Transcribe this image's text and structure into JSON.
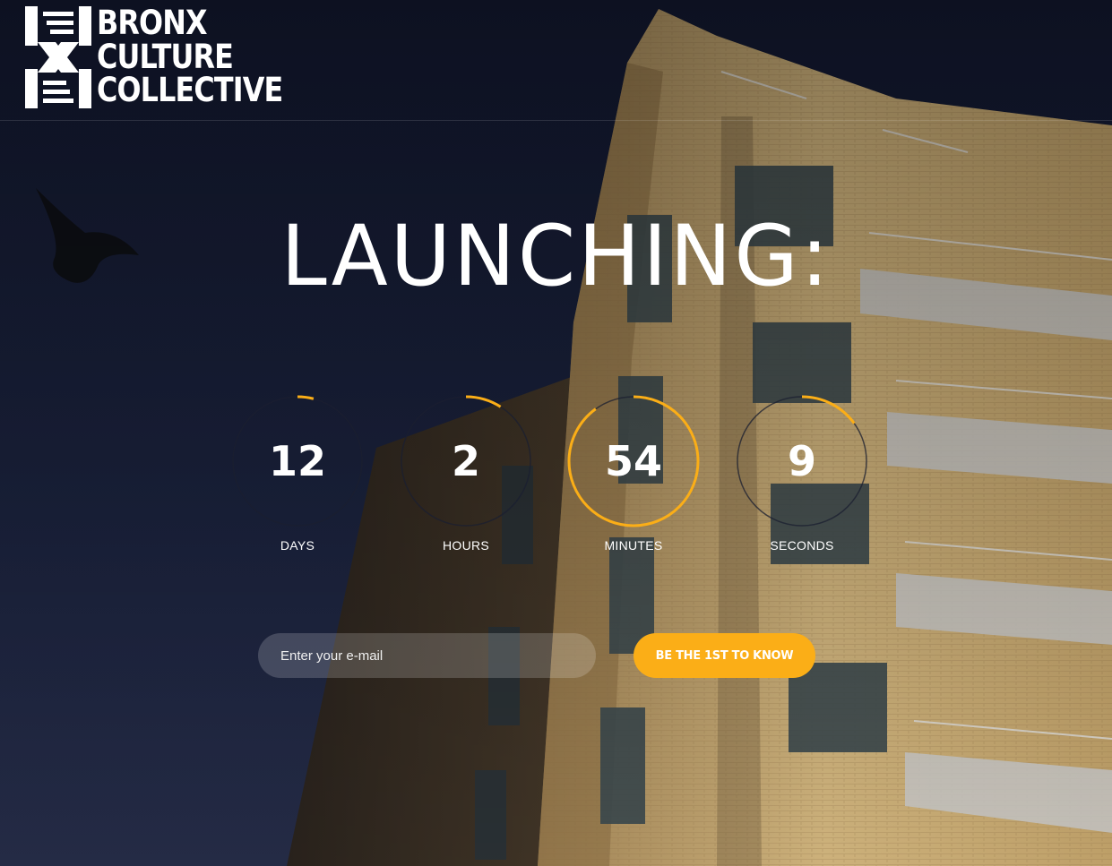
{
  "brand": {
    "lines": [
      "BRONX",
      "CULTURE",
      "COLLECTIVE"
    ]
  },
  "hero": {
    "title": "LAUNCHING:"
  },
  "countdown": [
    {
      "key": "days",
      "value": "12",
      "label": "DAYS",
      "progress": 0.04
    },
    {
      "key": "hours",
      "value": "2",
      "label": "HOURS",
      "progress": 0.09
    },
    {
      "key": "minutes",
      "value": "54",
      "label": "MINUTES",
      "progress": 0.9
    },
    {
      "key": "seconds",
      "value": "9",
      "label": "SECONDS",
      "progress": 0.15
    }
  ],
  "signup": {
    "placeholder": "Enter your e-mail",
    "button_label": "BE THE 1ST TO KNOW"
  },
  "colors": {
    "accent": "#fbae17",
    "ring_track": "#1b1f30",
    "background": "#14192e"
  }
}
